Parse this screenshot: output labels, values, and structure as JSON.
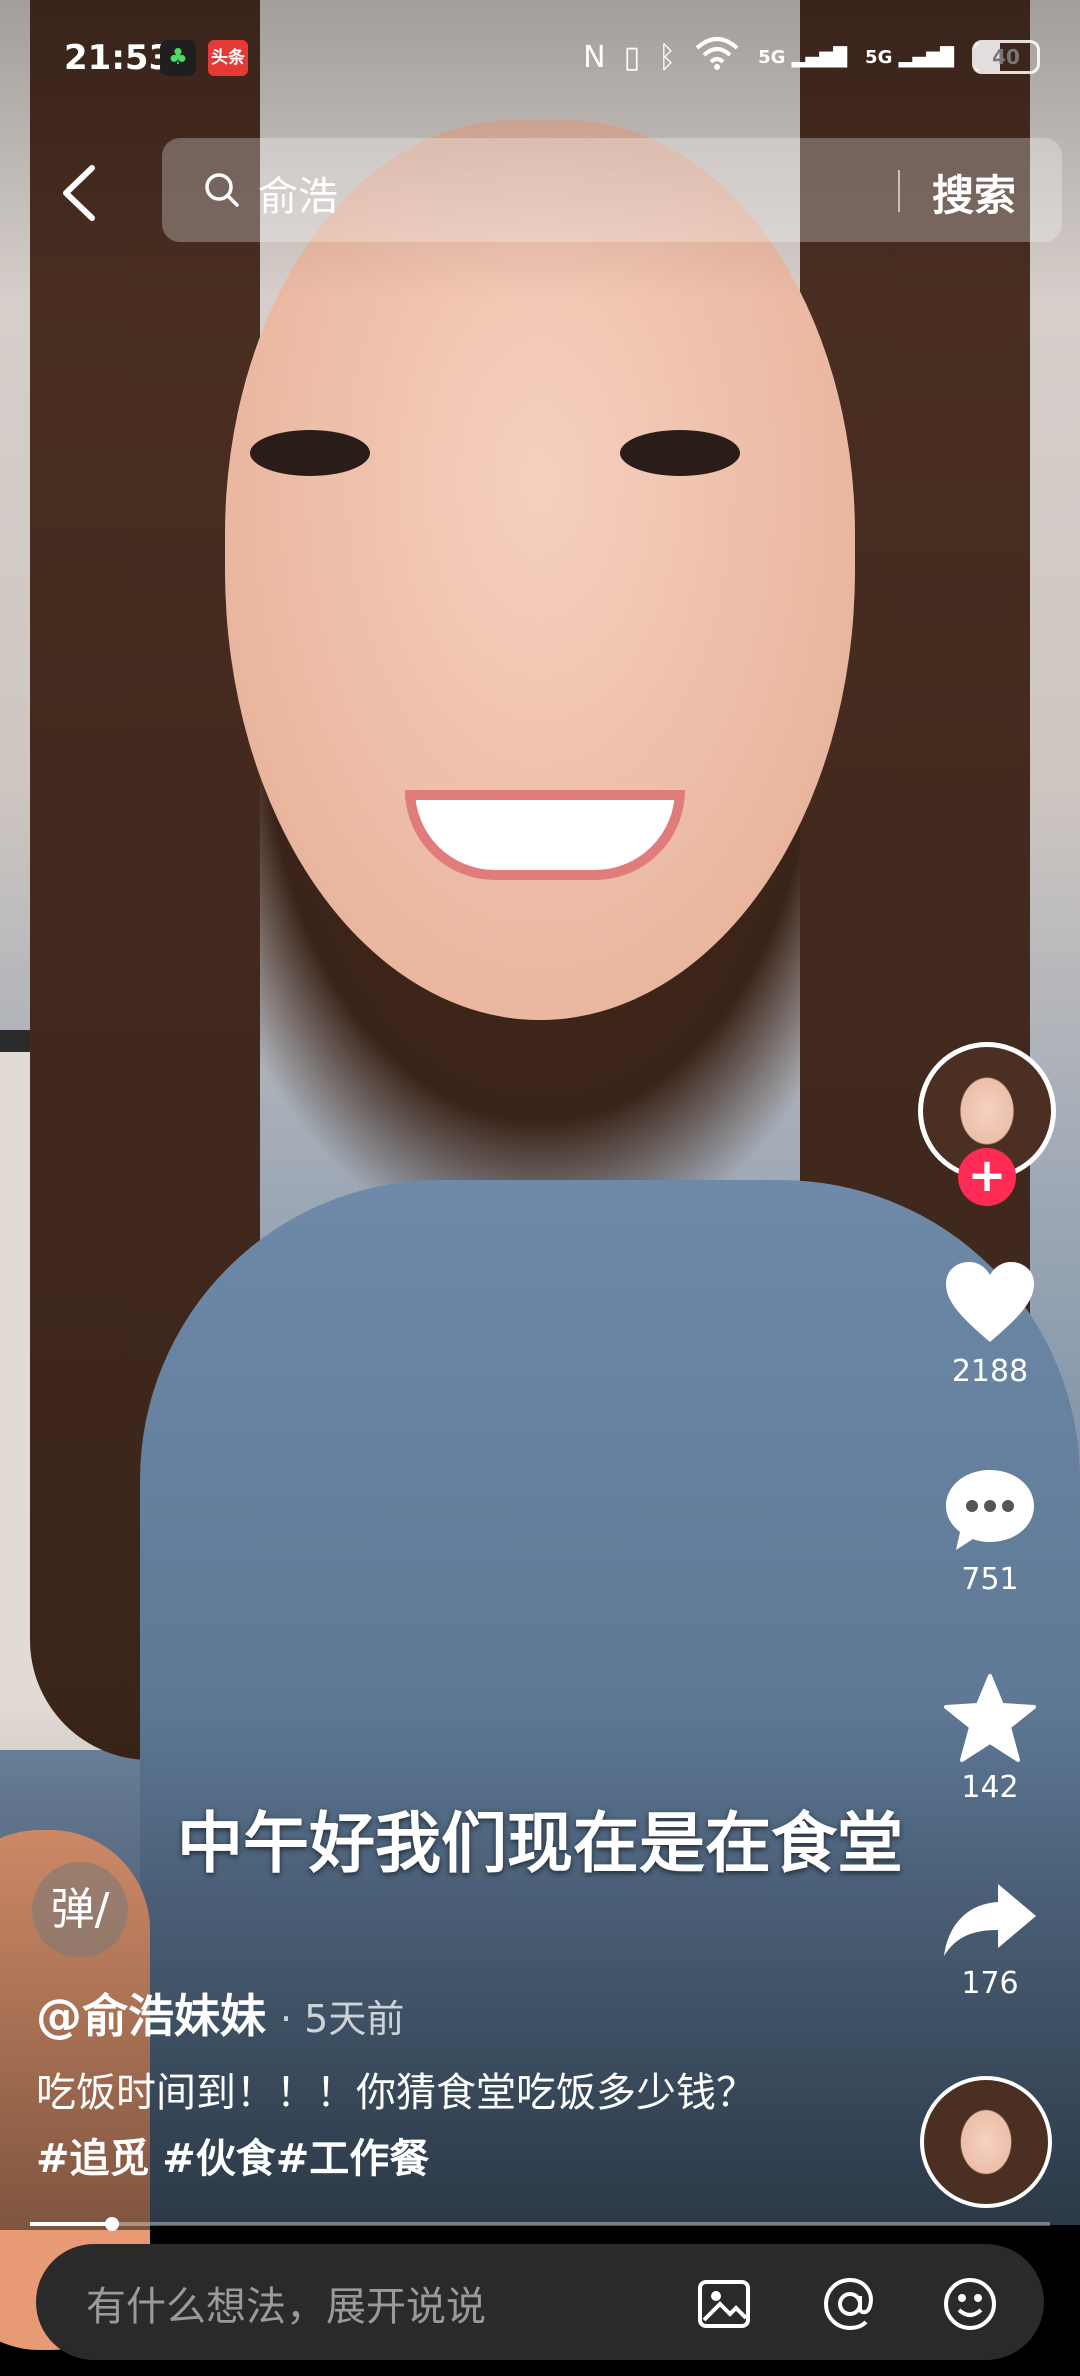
{
  "status_bar": {
    "time": "21:53",
    "app_badge_label": "头条",
    "battery": "40",
    "network_1": "5G",
    "network_2": "5G"
  },
  "search": {
    "query": "俞浩",
    "button_label": "搜索"
  },
  "rail": {
    "likes": "2188",
    "comments": "751",
    "favorites": "142",
    "shares": "176"
  },
  "video": {
    "subtitle": "中午好我们现在是在食堂",
    "danmaku_label": "弹",
    "author": "@俞浩妹妹",
    "posted": "· 5天前",
    "description_text": "吃饭时间到！！！你猜食堂吃饭多少钱？",
    "tags": [
      "#追觅",
      "#伙食",
      "#工作餐"
    ],
    "progress": 0.08
  },
  "comment_bar": {
    "placeholder": "有什么想法，展开说说"
  },
  "icons": {
    "back": "back-arrow-icon",
    "search": "search-icon",
    "like": "heart-icon",
    "comment": "comment-bubble-icon",
    "favorite": "star-icon",
    "share": "share-arrow-icon",
    "image": "image-icon",
    "mention": "at-icon",
    "emoji": "emoji-icon"
  },
  "colors": {
    "follow_accent": "#fe2c55",
    "comment_bar_bg": "#2a2a2a"
  }
}
